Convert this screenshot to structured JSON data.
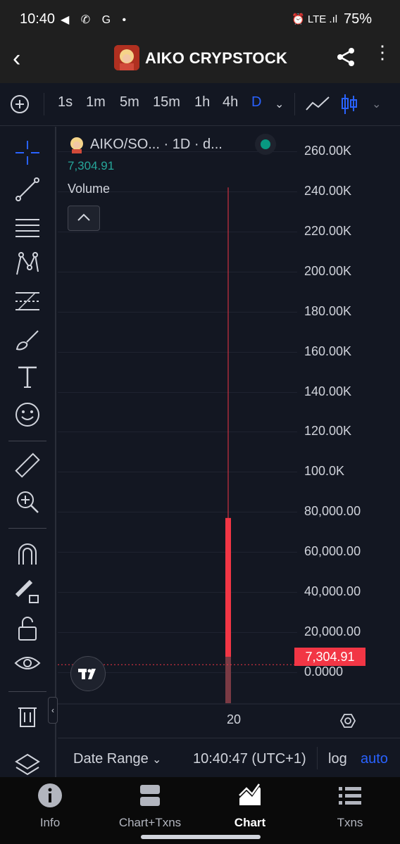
{
  "status_bar": {
    "time": "10:40",
    "icons": "◀ ✆ G •",
    "right_icons": "⏰ LTE .ıl",
    "battery": "75%"
  },
  "app_bar": {
    "title": "AIKO CRYPSTOCK"
  },
  "toolbar": {
    "timeframes": [
      "1s",
      "1m",
      "5m",
      "15m",
      "1h",
      "4h",
      "D"
    ],
    "active_timeframe": "D"
  },
  "legend": {
    "symbol": "AIKO/SO... · 1D · d...",
    "price": "7,304.91",
    "indicator": "Volume"
  },
  "chart_data": {
    "type": "bar",
    "y_tick_labels": [
      "260.00K",
      "240.00K",
      "220.00K",
      "200.00K",
      "180.00K",
      "160.00K",
      "140.00K",
      "120.00K",
      "100.0K",
      "80,000.00",
      "60,000.00",
      "40,000.00",
      "20,000.00",
      "0.0000"
    ],
    "x_tick_labels": [
      "20"
    ],
    "ylim": [
      0,
      260000
    ],
    "candle": {
      "open": 0,
      "high": 242000,
      "low": 0,
      "close": 77000,
      "color": "#f23645"
    },
    "last_price": 7304.91,
    "last_price_label": "7,304.91"
  },
  "bottom_bar": {
    "date_range": "Date Range",
    "time": "10:40:47 (UTC+1)",
    "log": "log",
    "auto": "auto"
  },
  "nav": [
    {
      "label": "Info",
      "icon": "info-icon"
    },
    {
      "label": "Chart+Txns",
      "icon": "split-icon"
    },
    {
      "label": "Chart",
      "icon": "chart-icon",
      "active": true
    },
    {
      "label": "Txns",
      "icon": "list-icon"
    }
  ],
  "colors": {
    "bg": "#131722",
    "accent": "#2962ff",
    "down": "#f23645",
    "up": "#26a69a"
  }
}
